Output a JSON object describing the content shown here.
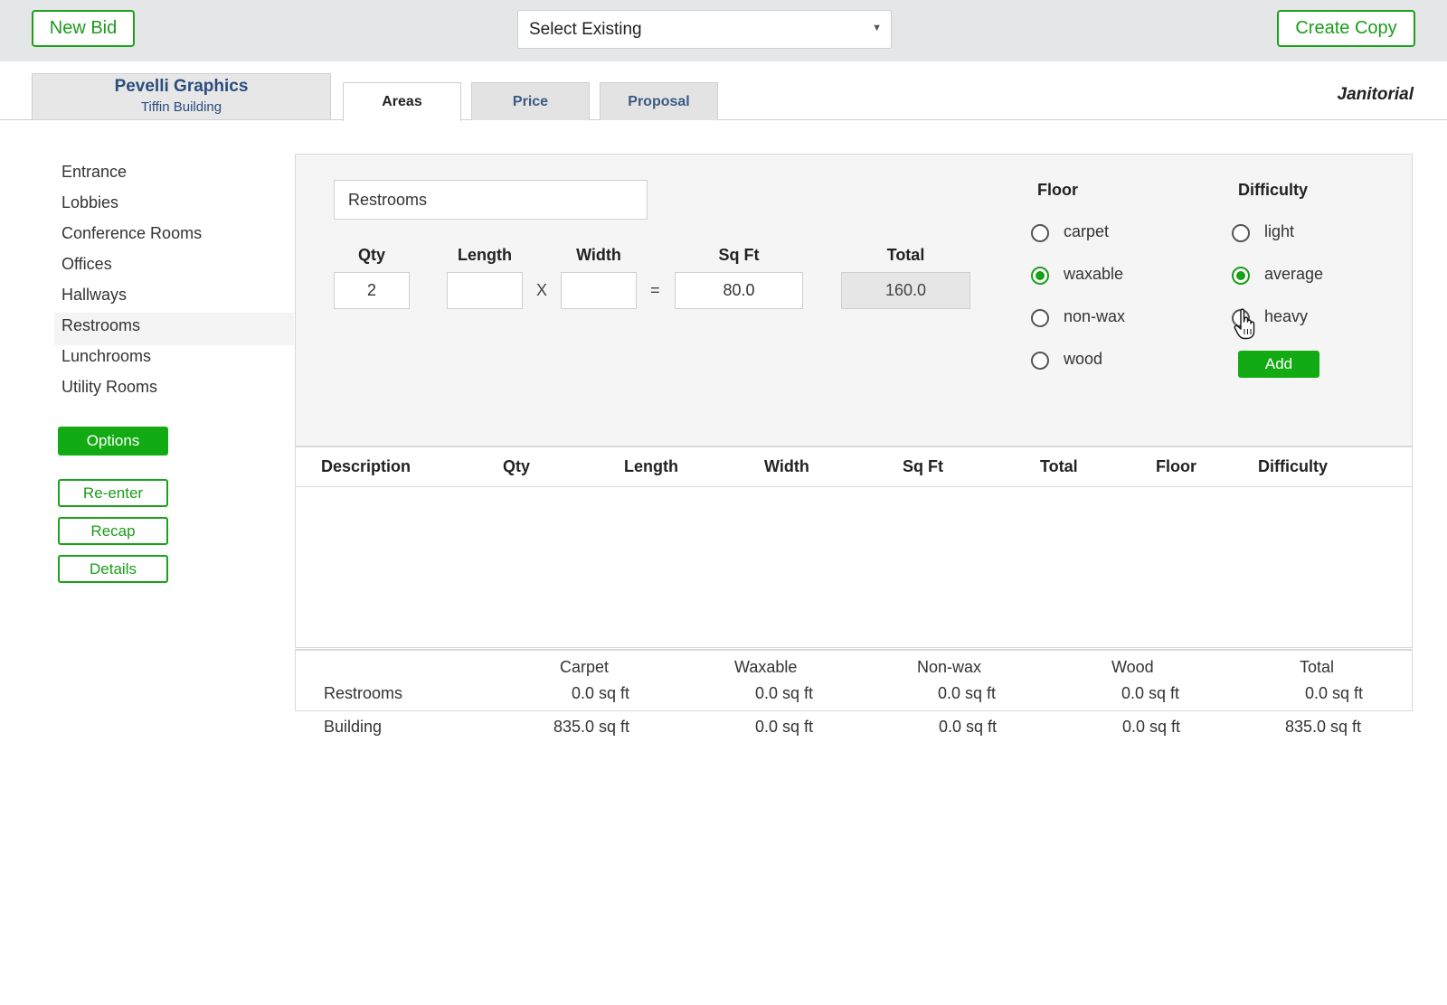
{
  "topbar": {
    "new_bid": "New Bid",
    "select_existing": "Select Existing",
    "create_copy": "Create Copy"
  },
  "client": {
    "name": "Pevelli Graphics",
    "building": "Tiffin Building"
  },
  "tabs": [
    {
      "label": "Areas",
      "active": true
    },
    {
      "label": "Price",
      "active": false
    },
    {
      "label": "Proposal",
      "active": false
    }
  ],
  "service_type": "Janitorial",
  "sidebar": {
    "items": [
      "Entrance",
      "Lobbies",
      "Conference Rooms",
      "Offices",
      "Hallways",
      "Restrooms",
      "Lunchrooms",
      "Utility Rooms"
    ],
    "selected": "Restrooms",
    "options": "Options",
    "reenter": "Re-enter",
    "recap": "Recap",
    "details": "Details"
  },
  "form": {
    "area_name": "Restrooms",
    "labels": {
      "qty": "Qty",
      "length": "Length",
      "width": "Width",
      "sqft": "Sq Ft",
      "total": "Total"
    },
    "qty": "2",
    "length": "",
    "width": "",
    "sqft": "80.0",
    "total": "160.0",
    "times": "X",
    "equals": "=",
    "floor_title": "Floor",
    "floor_options": [
      "carpet",
      "waxable",
      "non-wax",
      "wood"
    ],
    "floor_selected": "waxable",
    "difficulty_title": "Difficulty",
    "difficulty_options": [
      "light",
      "average",
      "heavy"
    ],
    "difficulty_selected": "average",
    "add": "Add"
  },
  "table": {
    "headers": [
      "Description",
      "Qty",
      "Length",
      "Width",
      "Sq Ft",
      "Total",
      "Floor",
      "Difficulty"
    ],
    "rows": []
  },
  "summary": {
    "headers": [
      "Carpet",
      "Waxable",
      "Non-wax",
      "Wood",
      "Total"
    ],
    "restrooms": {
      "label": "Restrooms",
      "values": [
        "0.0 sq ft",
        "0.0 sq ft",
        "0.0 sq ft",
        "0.0 sq ft",
        "0.0 sq ft"
      ]
    },
    "building": {
      "label": "Building",
      "values": [
        "835.0 sq ft",
        "0.0 sq ft",
        "0.0 sq ft",
        "0.0 sq ft",
        "835.0 sq ft"
      ]
    }
  },
  "colors": {
    "accent": "#13ab13",
    "link": "#2a4d7d"
  }
}
